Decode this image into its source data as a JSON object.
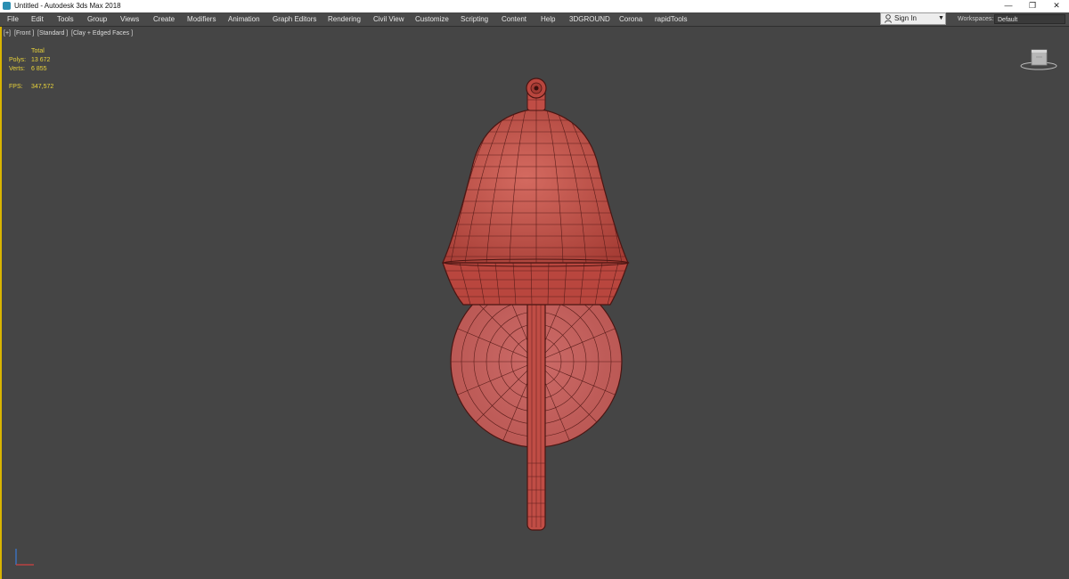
{
  "window": {
    "title": "Untitled - Autodesk 3ds Max 2018",
    "controls": {
      "minimize": "—",
      "restore": "❐",
      "close": "✕"
    }
  },
  "menu": [
    {
      "label": "File"
    },
    {
      "label": "Edit"
    },
    {
      "label": "Tools"
    },
    {
      "label": "Group"
    },
    {
      "label": "Views"
    },
    {
      "label": "Create"
    },
    {
      "label": "Modifiers"
    },
    {
      "label": "Animation"
    },
    {
      "label": "Graph Editors"
    },
    {
      "label": "Rendering"
    },
    {
      "label": "Civil View"
    },
    {
      "label": "Customize"
    },
    {
      "label": "Scripting"
    },
    {
      "label": "Content"
    },
    {
      "label": "Help"
    },
    {
      "label": "3DGROUND"
    },
    {
      "label": "Corona"
    },
    {
      "label": "rapidTools"
    }
  ],
  "account": {
    "sign_in_label": "Sign In",
    "caret": "▼"
  },
  "workspaces": {
    "label": "Workspaces:",
    "value": "Default"
  },
  "viewport": {
    "labels": [
      "[+]",
      "[Front ]",
      "[Standard ]",
      "[Clay + Edged Faces ]"
    ],
    "stats": {
      "header": "Total",
      "polys_label": "Polys:",
      "polys_value": "13 672",
      "verts_label": "Verts:",
      "verts_value": "6 855",
      "fps_label": "FPS:",
      "fps_value": "347,572"
    }
  },
  "colors": {
    "model_fill": "#c5554c",
    "model_wire": "#4a1512",
    "stat_text": "#e8d23a",
    "active_border": "#d8b400"
  }
}
